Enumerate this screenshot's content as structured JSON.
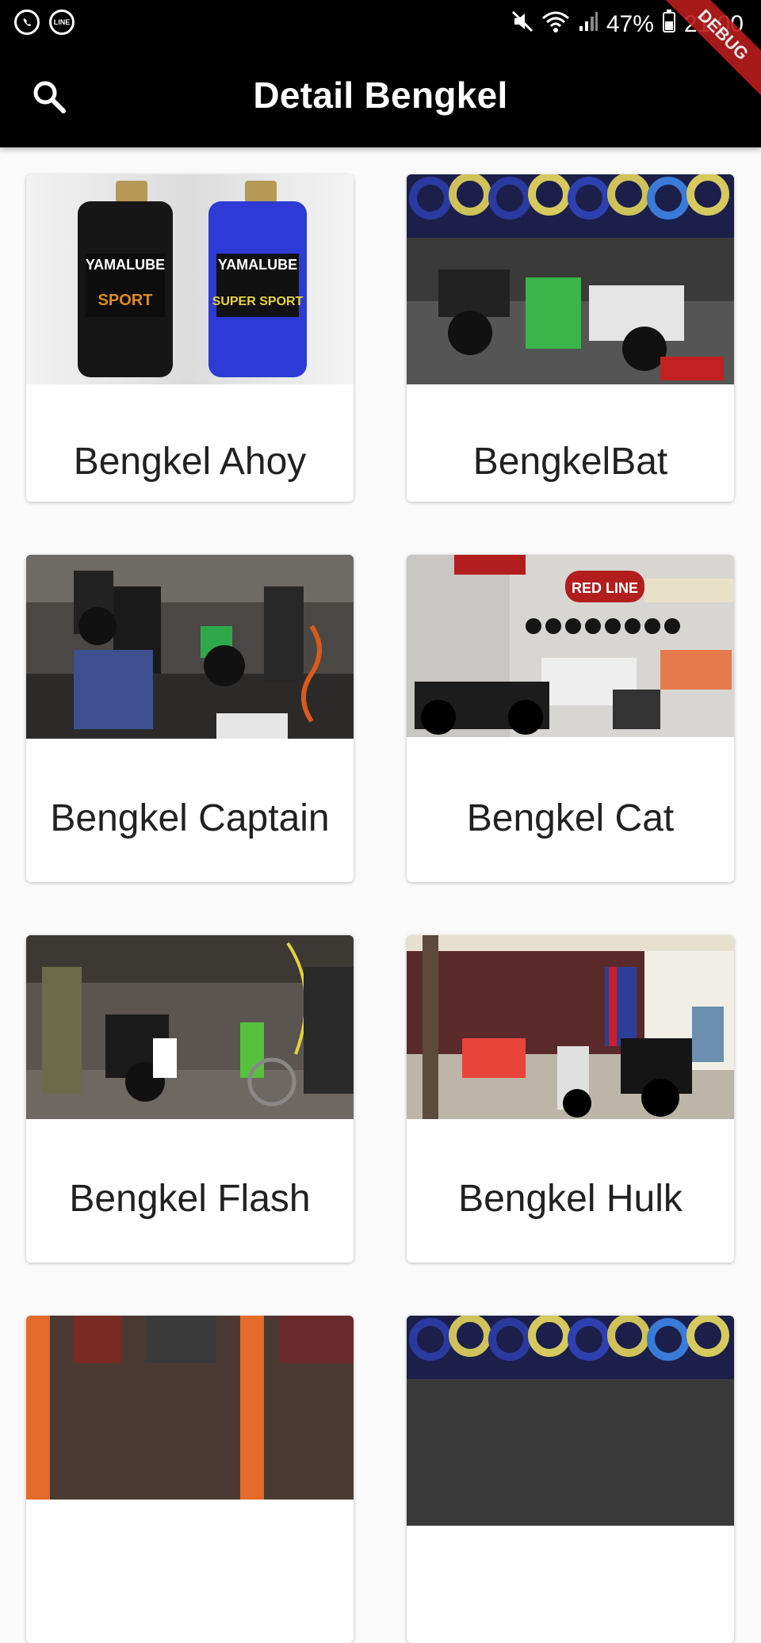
{
  "status_bar": {
    "notif_icons": [
      "whatsapp-icon",
      "line-icon"
    ],
    "line_text": "LINE",
    "battery": "47%",
    "time": "21:00"
  },
  "app_bar": {
    "title": "Detail Bengkel",
    "search_icon": "search-icon",
    "debug_banner": "DEBUG"
  },
  "workshops": [
    {
      "name": "Bengkel Ahoy",
      "image": "yamalube-oil-bottles",
      "bottle1_brand": "YAMALUBE",
      "bottle1_type": "SPORT",
      "bottle2_brand": "YAMALUBE",
      "bottle2_type": "SUPER SPORT"
    },
    {
      "name": "BengkelBat",
      "image": "tire-shop-motorcycles"
    },
    {
      "name": "Bengkel Captain",
      "image": "motorcycle-repair-crowd"
    },
    {
      "name": "Bengkel Cat",
      "image": "motorcycle-showroom",
      "sign": "RED LINE"
    },
    {
      "name": "Bengkel Flash",
      "image": "workshop-mechanics"
    },
    {
      "name": "Bengkel Hulk",
      "image": "mechanic-fixing-scooter"
    },
    {
      "name": "",
      "image": "workshop-partial"
    },
    {
      "name": "",
      "image": "tire-shop-partial"
    }
  ]
}
